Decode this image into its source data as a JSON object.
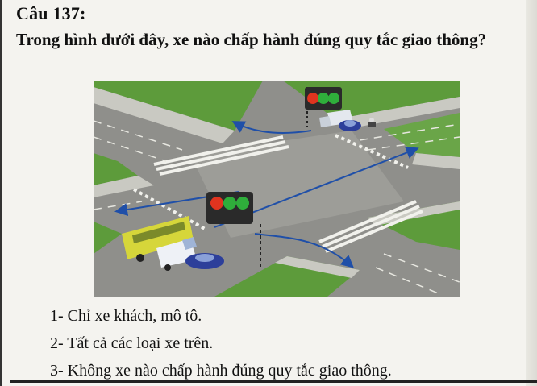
{
  "question": {
    "number": "Câu 137:",
    "text": "Trong hình dưới đây, xe nào chấp hành đúng quy tắc giao thông?"
  },
  "figure": {
    "traffic_light_top": {
      "lights": [
        "red",
        "green",
        "green"
      ]
    },
    "traffic_light_front": {
      "lights": [
        "red",
        "green",
        "green"
      ]
    },
    "colors": {
      "grass": "#5d9b3b",
      "road": "#8f8f8b",
      "sidewalk": "#c9c9c2",
      "arrow": "#1f4fa8",
      "bus": "#d6d63a",
      "car": "#2d3f9a",
      "truck": "#e4e8ee"
    }
  },
  "answers": [
    {
      "text": "1- Chỉ xe khách, mô tô."
    },
    {
      "text": "2- Tất cả các loại xe trên."
    },
    {
      "text": "3- Không xe nào chấp hành đúng quy tắc giao thông."
    }
  ]
}
